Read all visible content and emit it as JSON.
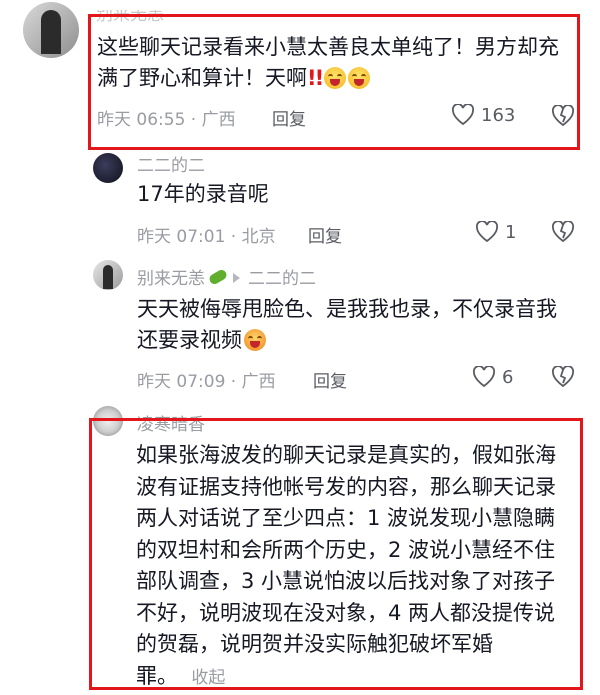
{
  "comments": [
    {
      "name": "别来无恙",
      "text": "这些聊天记录看来小慧太善良太单纯了！男方却充满了野心和算计！天啊",
      "time": "昨天 06:55 · 广西",
      "reply": "回复",
      "likes": "163"
    },
    {
      "name": "二二的二",
      "text": "17年的录音呢",
      "time": "昨天 07:01 · 北京",
      "reply": "回复",
      "likes": "1"
    },
    {
      "name": "别来无恙",
      "reply_to": "二二的二",
      "text": "天天被侮辱甩脸色、是我我也录，不仅录音我还要录视频",
      "time": "昨天 07:09 · 广西",
      "reply": "回复",
      "likes": "6"
    },
    {
      "name": "凌寒暗香",
      "text": "如果张海波发的聊天记录是真实的，假如张海波有证据支持他帐号发的内容，那么聊天记录两人对话说了至少四点：1 波说发现小慧隐瞒的双坦村和会所两个历史，2 波说小慧经不住部队调查，3 小慧说怕波以后找对象了对孩子不好，说明波现在没对象，4 两人都没提传说的贺磊，说明贺并没实际触犯破坏军婚罪。",
      "collapse": "收起"
    }
  ],
  "colors": {
    "highlight_border": "#e3171b",
    "meta_gray": "#9a9ca3"
  }
}
